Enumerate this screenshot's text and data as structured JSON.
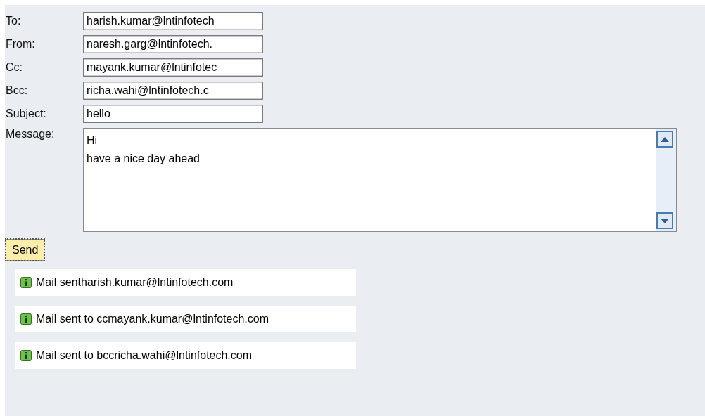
{
  "fields": [
    {
      "label": "To:",
      "value": "harish.kumar@lntinfotech"
    },
    {
      "label": "From:",
      "value": "naresh.garg@lntinfotech."
    },
    {
      "label": "Cc:",
      "value": "mayank.kumar@lntinfotec"
    },
    {
      "label": "Bcc:",
      "value": "richa.wahi@lntinfotech.c"
    },
    {
      "label": "Subject:",
      "value": "hello"
    }
  ],
  "message": {
    "label": "Message:",
    "lines": [
      "Hi",
      "have a nice day ahead"
    ]
  },
  "send_button": {
    "label": "Send",
    "focused": true
  },
  "notifications": [
    {
      "text": "Mail sentharish.kumar@lntinfotech.com"
    },
    {
      "text": "Mail sent to ccmayank.kumar@lntinfotech.com"
    },
    {
      "text": "Mail sent to bccricha.wahi@lntinfotech.com"
    }
  ]
}
